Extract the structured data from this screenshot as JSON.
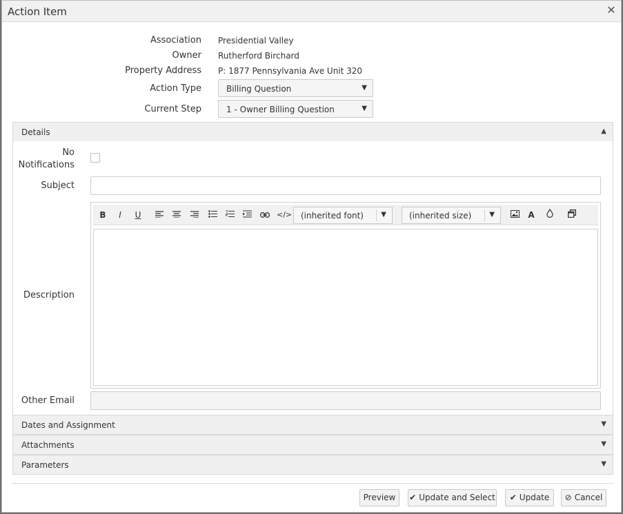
{
  "dialog": {
    "title": "Action Item",
    "close_icon": "close-icon"
  },
  "info": {
    "association_label": "Association",
    "association_value": "Presidential Valley",
    "owner_label": "Owner",
    "owner_value": "Rutherford Birchard",
    "address_label": "Property Address",
    "address_value": "P: 1877 Pennsylvania Ave Unit 320",
    "action_type_label": "Action Type",
    "action_type_value": "Billing Question",
    "current_step_label": "Current Step",
    "current_step_value": "1 - Owner Billing Question"
  },
  "details": {
    "header": "Details",
    "no_notifications_label_line1": "No",
    "no_notifications_label_line2": "Notifications",
    "subject_label": "Subject",
    "subject_value": "",
    "description_label": "Description",
    "other_email_label": "Other Email",
    "other_email_value": ""
  },
  "editor": {
    "bold": "B",
    "italic": "I",
    "underline": "U",
    "font_select": "(inherited font)",
    "size_select": "(inherited size)",
    "text_color": "A"
  },
  "panels": {
    "dates": "Dates and Assignment",
    "attachments": "Attachments",
    "parameters": "Parameters"
  },
  "buttons": {
    "preview": "Preview",
    "update_select": "Update and Select",
    "update": "Update",
    "cancel": "Cancel"
  }
}
